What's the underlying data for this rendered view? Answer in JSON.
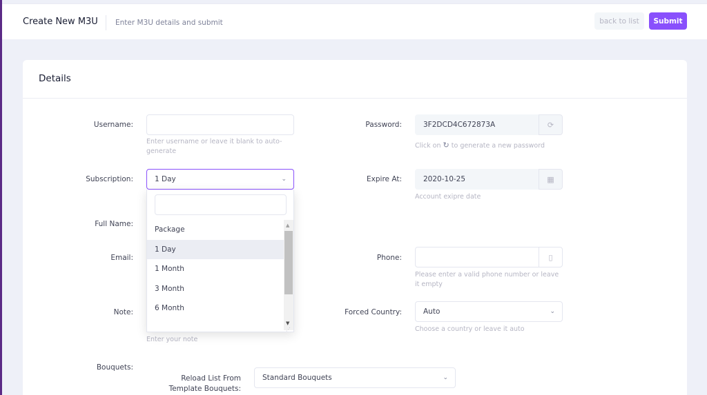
{
  "header": {
    "title": "Create New M3U",
    "subtitle": "Enter M3U details and submit",
    "back_label": "back to list",
    "submit_label": "Submit"
  },
  "card": {
    "title": "Details"
  },
  "fields": {
    "username": {
      "label": "Username:",
      "value": "",
      "help": "Enter username or leave it blank to auto-generate"
    },
    "password": {
      "label": "Password:",
      "value": "3F2DCD4C672873A",
      "help_before": "Click on",
      "help_after": "to generate a new password"
    },
    "subscription": {
      "label": "Subscription:",
      "value": "1 Day"
    },
    "expire": {
      "label": "Expire At:",
      "value": "2020-10-25",
      "help": "Account exipre date"
    },
    "full_name": {
      "label": "Full Name:"
    },
    "email": {
      "label": "Email:"
    },
    "phone": {
      "label": "Phone:",
      "help": "Please enter a valid phone number or leave it empty"
    },
    "note": {
      "label": "Note:",
      "help": "Enter your note"
    },
    "forced_country": {
      "label": "Forced Country:",
      "value": "Auto",
      "help": "Choose a country or leave it auto"
    },
    "bouquets": {
      "label": "Bouquets:",
      "reload_label": "Reload List From Template Bouquets:",
      "value": "Standard Bouquets"
    }
  },
  "dropdown": {
    "search_value": "",
    "options": [
      "Package",
      "1 Day",
      "1 Month",
      "3 Month",
      "6 Month"
    ],
    "selected": "1 Day"
  },
  "colors": {
    "accent": "#8950fc",
    "left_edge": "#5b2a86"
  }
}
